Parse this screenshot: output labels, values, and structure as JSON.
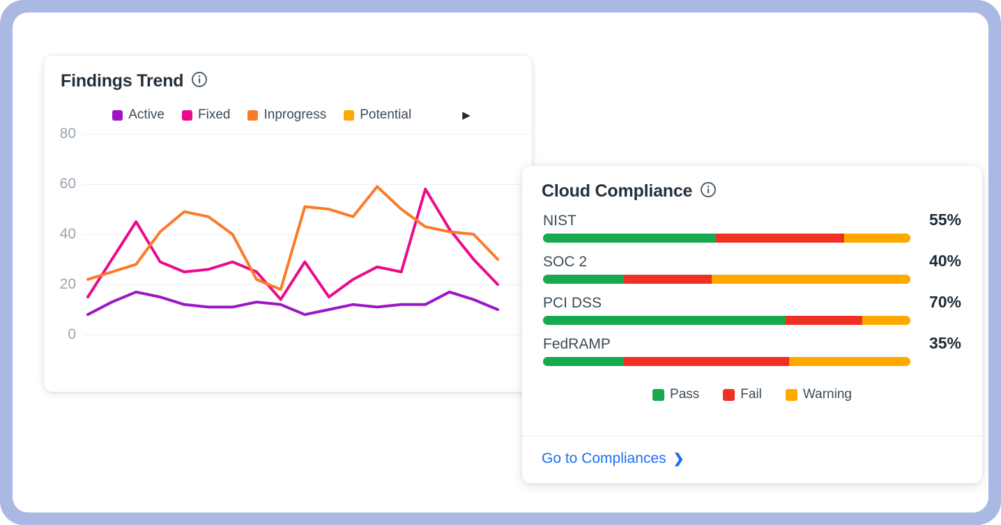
{
  "theme": {
    "frame_color": "#aab9e3",
    "page_bg": "#ffffff",
    "link_color": "#1b6ef3",
    "text_dark": "#1d2b36",
    "text_muted": "#3c4a55",
    "tick_color": "#9aa4ad",
    "grid_color": "#eceef0"
  },
  "findings_card": {
    "title": "Findings Trend",
    "info_icon": "info-circle-icon",
    "next_icon": "chevron-right-icon",
    "legend": [
      {
        "label": "Active",
        "color": "#9c16c6"
      },
      {
        "label": "Fixed",
        "color": "#ec0a8c"
      },
      {
        "label": "Inprogress",
        "color": "#fa7b28"
      },
      {
        "label": "Potential",
        "color": "#ffa800"
      }
    ]
  },
  "chart_data": {
    "type": "line",
    "title": "Findings Trend",
    "xlabel": "",
    "ylabel": "",
    "ylim": [
      0,
      80
    ],
    "yticks": [
      80,
      60,
      40,
      20,
      0
    ],
    "grid": true,
    "legend_position": "top-center",
    "x": [
      1,
      2,
      3,
      4,
      5,
      6,
      7,
      8,
      9,
      10,
      11,
      12,
      13,
      14,
      15,
      16,
      17,
      18
    ],
    "series": [
      {
        "name": "Active",
        "color": "#9c16c6",
        "values": [
          8,
          13,
          17,
          15,
          12,
          11,
          11,
          13,
          12,
          8,
          10,
          12,
          11,
          12,
          12,
          17,
          14,
          10
        ]
      },
      {
        "name": "Fixed",
        "color": "#ec0a8c",
        "values": [
          15,
          30,
          45,
          29,
          25,
          26,
          29,
          25,
          14,
          29,
          15,
          22,
          27,
          25,
          58,
          42,
          30,
          20
        ]
      },
      {
        "name": "Inprogress",
        "color": "#fa7b28",
        "values": [
          22,
          25,
          28,
          41,
          49,
          47,
          40,
          22,
          18,
          51,
          50,
          47,
          59,
          50,
          43,
          41,
          40,
          30
        ]
      },
      {
        "name": "Potential",
        "color": "#ffa800",
        "values": []
      }
    ]
  },
  "compliance_card": {
    "title": "Cloud Compliance",
    "info_icon": "info-circle-icon",
    "colors": {
      "pass": "#17a94e",
      "fail": "#ef3124",
      "warning": "#ffa800"
    },
    "rows": [
      {
        "name": "NIST",
        "percent": "55%",
        "pass": 47,
        "fail": 35,
        "warning": 18
      },
      {
        "name": "SOC 2",
        "percent": "40%",
        "pass": 22,
        "fail": 24,
        "warning": 54
      },
      {
        "name": "PCI DSS",
        "percent": "70%",
        "pass": 66,
        "fail": 21,
        "warning": 13
      },
      {
        "name": "FedRAMP",
        "percent": "35%",
        "pass": 22,
        "fail": 45,
        "warning": 33
      }
    ],
    "legend": [
      {
        "label": "Pass",
        "color": "#17a94e"
      },
      {
        "label": "Fail",
        "color": "#ef3124"
      },
      {
        "label": "Warning",
        "color": "#ffa800"
      }
    ],
    "footer_link": "Go to Compliances",
    "footer_icon": "chevron-right-icon"
  }
}
